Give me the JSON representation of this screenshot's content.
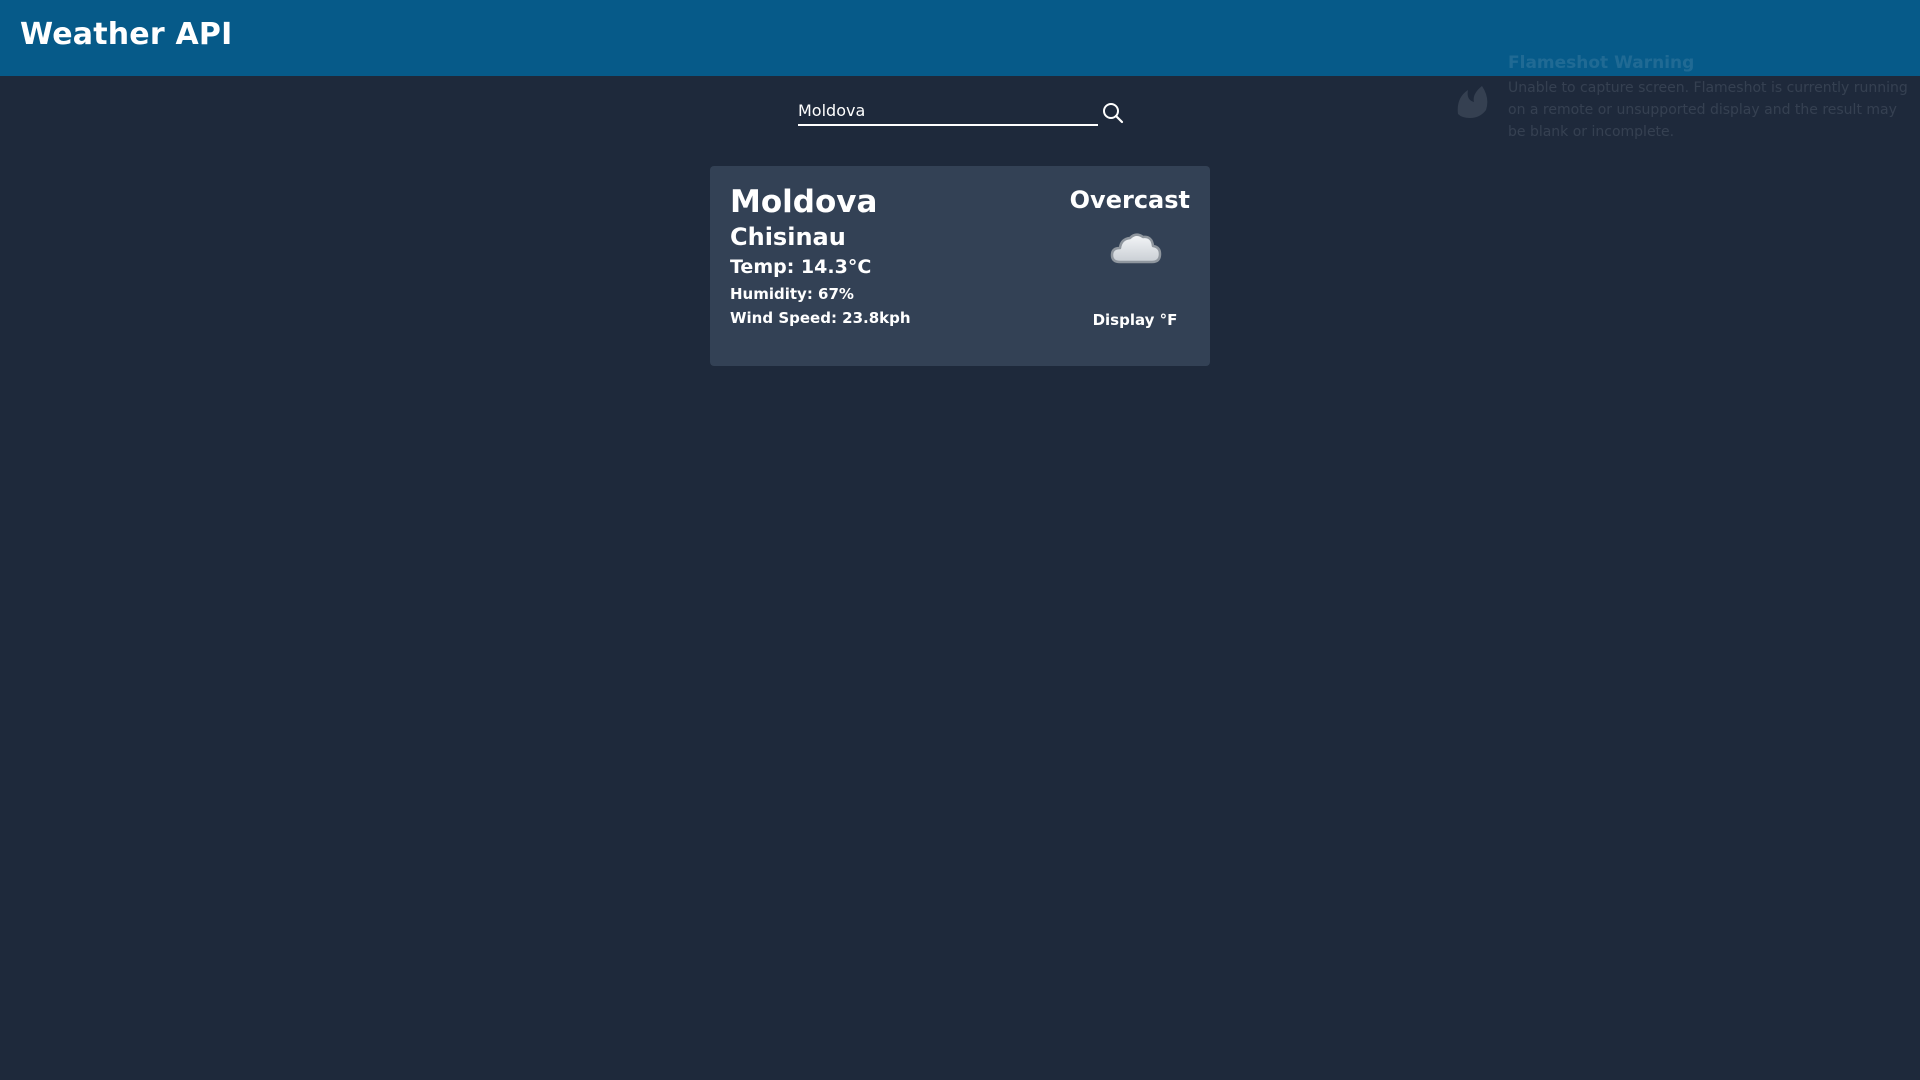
{
  "header": {
    "title": "Weather API"
  },
  "search": {
    "value": "Moldova",
    "icon": "search-icon"
  },
  "weather": {
    "country": "Moldova",
    "city": "Chisinau",
    "temp": "Temp: 14.3°C",
    "humidity": "Humidity: 67%",
    "wind": "Wind Speed: 23.8kph",
    "condition": "Overcast",
    "condition_icon": "cloud-icon",
    "unit_toggle_label": "Display °F"
  },
  "overlay": {
    "title": "Flameshot Warning",
    "text": "Unable to capture screen. Flameshot is currently running on a remote or unsupported display and the result may be blank or incomplete."
  },
  "colors": {
    "header_bg": "#065a89",
    "page_bg": "#1e293b",
    "card_bg": "#334155",
    "text": "#ffffff"
  }
}
